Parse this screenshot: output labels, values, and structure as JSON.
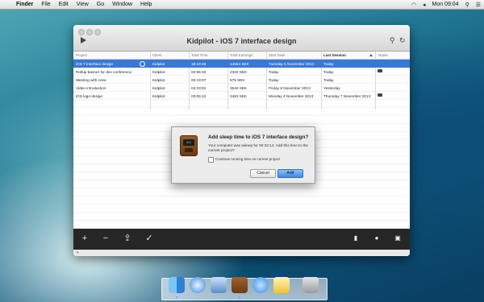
{
  "menubar": {
    "apple": "",
    "items": [
      "Finder",
      "File",
      "Edit",
      "View",
      "Go",
      "Window",
      "Help"
    ],
    "clock": "Mon 09:04",
    "status_icons": [
      "wifi-icon",
      "volume-icon",
      "search-icon",
      "list-icon"
    ]
  },
  "window": {
    "title": "Kidpilot - iOS 7 interface design",
    "columns": [
      "Project",
      "Client",
      "Total Time",
      "Total Earnings",
      "Start Date",
      "Last Session",
      "Notes"
    ],
    "rows": [
      {
        "project": "iOS 7 interface design",
        "client": "Kidpilot",
        "time": "18:19:48",
        "earnings": "14664 SEK",
        "start": "Tuesday 5 November 2013",
        "last": "Today",
        "note": false
      },
      {
        "project": "Rollup banner for dev conference",
        "client": "Kidpilot",
        "time": "02:55:32",
        "earnings": "2340 SEK",
        "start": "Today",
        "last": "Today",
        "note": true
      },
      {
        "project": "Meeting with crew",
        "client": "Kidpilot",
        "time": "00:43:07",
        "earnings": "575 SEK",
        "start": "Today",
        "last": "Today",
        "note": false
      },
      {
        "project": "Video introduction",
        "client": "Kidpilot",
        "time": "04:33:02",
        "earnings": "3640 SEK",
        "start": "Friday 8 November 2013",
        "last": "Yesterday",
        "note": false
      },
      {
        "project": "iOS logo design",
        "client": "Kidpilot",
        "time": "03:06:12",
        "earnings": "2483 SEK",
        "start": "Monday 4 November 2013",
        "last": "Thursday 7 November 2013",
        "note": true
      }
    ],
    "toolbar": {
      "add": "+",
      "remove": "−",
      "share": "⇪",
      "check": "✓"
    }
  },
  "dialog": {
    "title": "Add sleep time to iOS 7 interface design?",
    "message": "Your computer was asleep for 00:32:14. Add this time to the current project?",
    "checkbox_label": "Continue running time on current project",
    "cancel": "Cancel",
    "add": "Add",
    "icon_screen": "8:0"
  },
  "dock": {
    "apps": [
      "finder-icon",
      "safari-icon",
      "preview-icon",
      "kidpilot-icon",
      "messages-icon",
      "notes-icon",
      "trash-icon"
    ]
  },
  "colors": {
    "selection": "#3878d8",
    "toolbar": "#262626",
    "accent": "#3c8ae8"
  }
}
